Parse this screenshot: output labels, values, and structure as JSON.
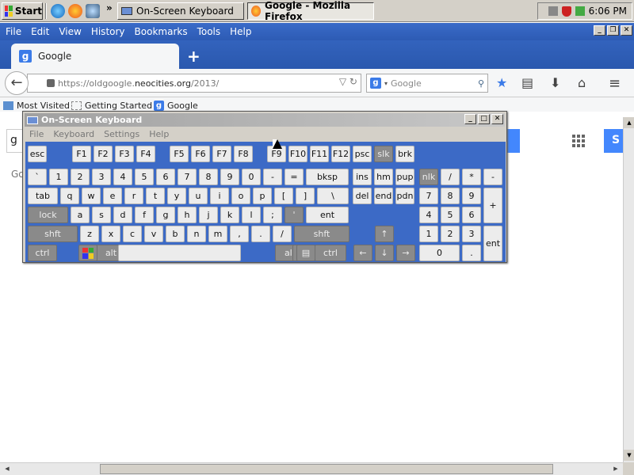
{
  "taskbar": {
    "start_label": "Start",
    "task_osk": "On-Screen Keyboard",
    "task_firefox": "Google - Mozilla Firefox",
    "clock": "6:06 PM"
  },
  "firefox": {
    "menus": [
      "File",
      "Edit",
      "View",
      "History",
      "Bookmarks",
      "Tools",
      "Help"
    ],
    "tab_title": "Google",
    "url_prefix": "https://oldgoogle.",
    "url_domain": "neocities.org",
    "url_path": "/2013/",
    "search_placeholder": "Google",
    "bookmarks": [
      "Most Visited",
      "Getting Started",
      "Google"
    ]
  },
  "page": {
    "search_text": "g",
    "go_text": "Go",
    "signin_text": "S"
  },
  "osk": {
    "title": "On-Screen Keyboard",
    "menus": [
      "File",
      "Keyboard",
      "Settings",
      "Help"
    ],
    "rows": [
      [
        "esc",
        "F1",
        "F2",
        "F3",
        "F4",
        "F5",
        "F6",
        "F7",
        "F8",
        "F9",
        "F10",
        "F11",
        "F12",
        "psc",
        "slk",
        "brk"
      ],
      [
        "`",
        "1",
        "2",
        "3",
        "4",
        "5",
        "6",
        "7",
        "8",
        "9",
        "0",
        "-",
        "=",
        "bksp",
        "ins",
        "hm",
        "pup",
        "nlk",
        "/",
        "*",
        "-"
      ],
      [
        "tab",
        "q",
        "w",
        "e",
        "r",
        "t",
        "y",
        "u",
        "i",
        "o",
        "p",
        "[",
        "]",
        "\\",
        "del",
        "end",
        "pdn",
        "7",
        "8",
        "9",
        "+"
      ],
      [
        "lock",
        "a",
        "s",
        "d",
        "f",
        "g",
        "h",
        "j",
        "k",
        "l",
        ";",
        "'",
        "ent",
        "4",
        "5",
        "6"
      ],
      [
        "shft",
        "z",
        "x",
        "c",
        "v",
        "b",
        "n",
        "m",
        ",",
        ".",
        "/",
        "shft",
        "↑",
        "1",
        "2",
        "3",
        "ent"
      ],
      [
        "ctrl",
        "alt",
        "alt",
        "ctrl",
        "←",
        "↓",
        "→",
        "0",
        "."
      ]
    ]
  }
}
